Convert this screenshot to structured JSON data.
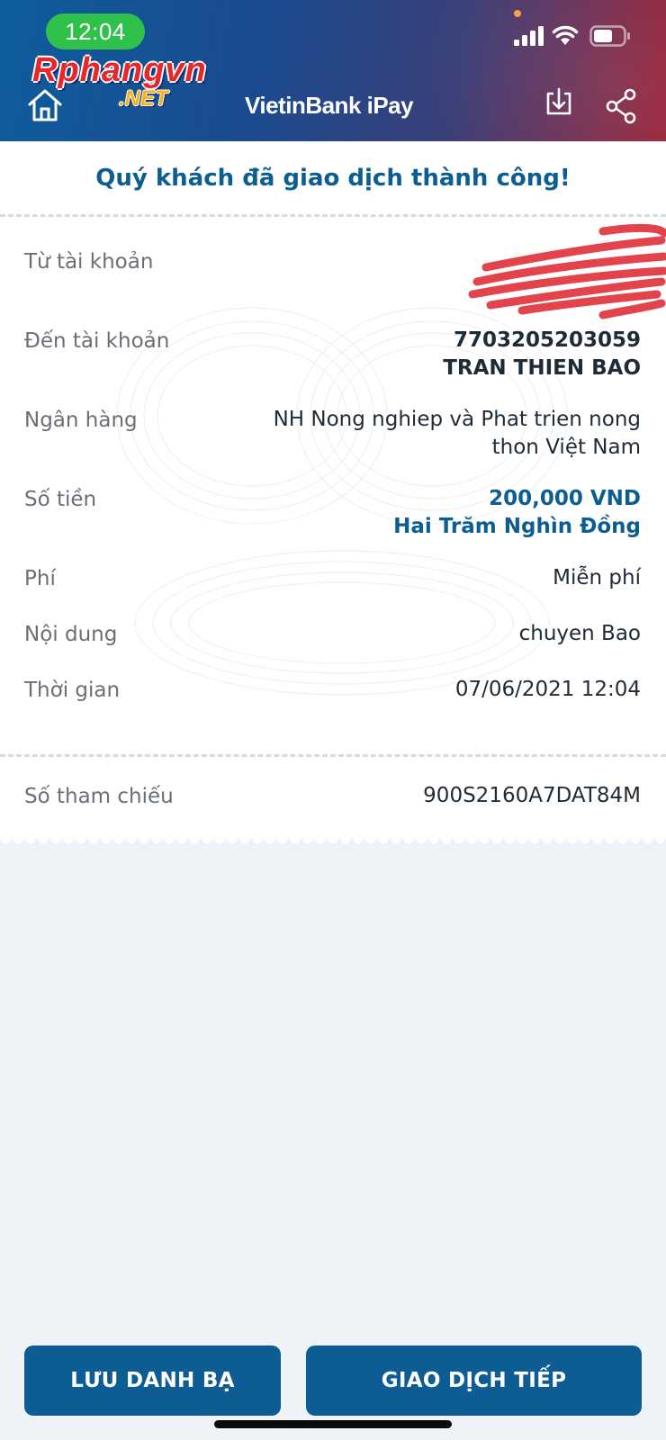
{
  "status_bar": {
    "time": "12:04",
    "icons": [
      "signal-icon",
      "wifi-icon",
      "battery-icon"
    ]
  },
  "watermark": {
    "main": "Rphangvn",
    "net": ".NET"
  },
  "header": {
    "brand": "VietinBank iPay",
    "icons": [
      "home-icon",
      "download-icon",
      "share-icon"
    ],
    "accent": "#0d5e90"
  },
  "receipt": {
    "title": "Quý khách đã giao dịch thành công!",
    "from_account": {
      "label": "Từ tài khoản",
      "value": ""
    },
    "to_account": {
      "label": "Đến tài khoản",
      "number": "7703205203059",
      "name": "TRAN THIEN BAO"
    },
    "bank": {
      "label": "Ngân hàng",
      "line1": "NH Nong nghiep và Phat trien nong",
      "line2": "thon Việt Nam"
    },
    "amount": {
      "label": "Số tiền",
      "value": "200,000 VND",
      "words": "Hai Trăm Nghìn Đồng"
    },
    "fee": {
      "label": "Phí",
      "value": "Miễn phí"
    },
    "content": {
      "label": "Nội dung",
      "value": "chuyen Bao"
    },
    "time": {
      "label": "Thời gian",
      "value": "07/06/2021 12:04"
    },
    "reference": {
      "label": "Số tham chiếu",
      "value": "900S2160A7DAT84M"
    }
  },
  "actions": {
    "save_contact": "LƯU DANH BẠ",
    "next_transaction": "GIAO DỊCH TIẾP"
  }
}
